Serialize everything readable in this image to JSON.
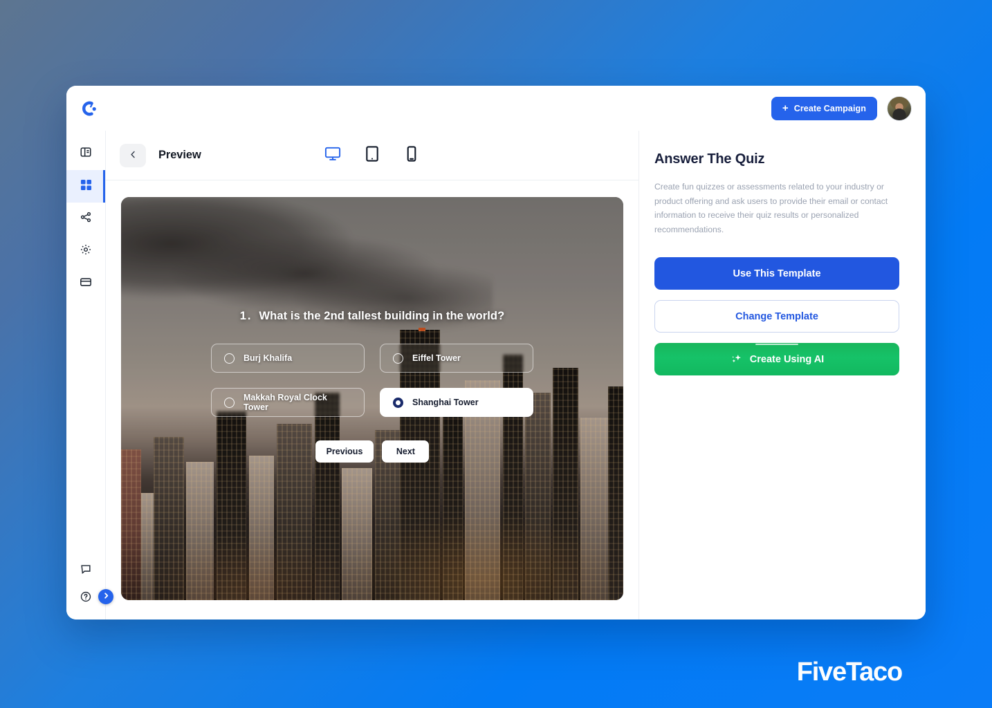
{
  "brand": {
    "watermark": "FiveTaco"
  },
  "topbar": {
    "logo_icon": "brand-c-logo-icon",
    "create_campaign_label": "Create Campaign",
    "plus_icon": "plus-icon",
    "avatar_name": "user-avatar"
  },
  "sidebar": {
    "items": [
      {
        "icon": "layout-panel-icon",
        "name": "sidebar-item-layout",
        "active": false
      },
      {
        "icon": "grid-icon",
        "name": "sidebar-item-templates",
        "active": true
      },
      {
        "icon": "share-icon",
        "name": "sidebar-item-share",
        "active": false
      },
      {
        "icon": "gear-icon",
        "name": "sidebar-item-settings",
        "active": false
      },
      {
        "icon": "credit-card-icon",
        "name": "sidebar-item-billing",
        "active": false
      }
    ],
    "bottom_items": [
      {
        "icon": "chat-bubble-icon",
        "name": "sidebar-item-feedback"
      },
      {
        "icon": "help-circle-icon",
        "name": "sidebar-item-help"
      }
    ],
    "expand_icon": "chevron-right-icon"
  },
  "preview": {
    "back_icon": "chevron-left-icon",
    "title": "Preview",
    "devices": [
      {
        "label": "desktop",
        "icon": "monitor-icon",
        "active": true
      },
      {
        "label": "tablet",
        "icon": "tablet-icon",
        "active": false
      },
      {
        "label": "mobile",
        "icon": "mobile-icon",
        "active": false
      }
    ]
  },
  "quiz": {
    "question_number": "1.",
    "question": "What is the 2nd tallest building in the world?",
    "options": [
      {
        "label": "Burj Khalifa",
        "selected": false
      },
      {
        "label": "Eiffel Tower",
        "selected": false
      },
      {
        "label": "Makkah Royal Clock Tower",
        "selected": false
      },
      {
        "label": "Shanghai Tower",
        "selected": true
      }
    ],
    "previous_label": "Previous",
    "next_label": "Next"
  },
  "panel": {
    "title": "Answer The Quiz",
    "description": "Create fun quizzes or assessments related to your industry or product offering and ask users to provide their email or contact information to receive their quiz results or personalized recommendations.",
    "use_template_label": "Use This Template",
    "change_template_label": "Change Template",
    "create_ai_label": "Create Using AI",
    "ai_icon": "sparkle-icon"
  },
  "colors": {
    "accent_blue": "#2563eb",
    "primary_blue": "#2257e0",
    "ai_green": "#16c268",
    "page_bg_blue": "#037bf5",
    "title_navy": "#181f3c"
  }
}
